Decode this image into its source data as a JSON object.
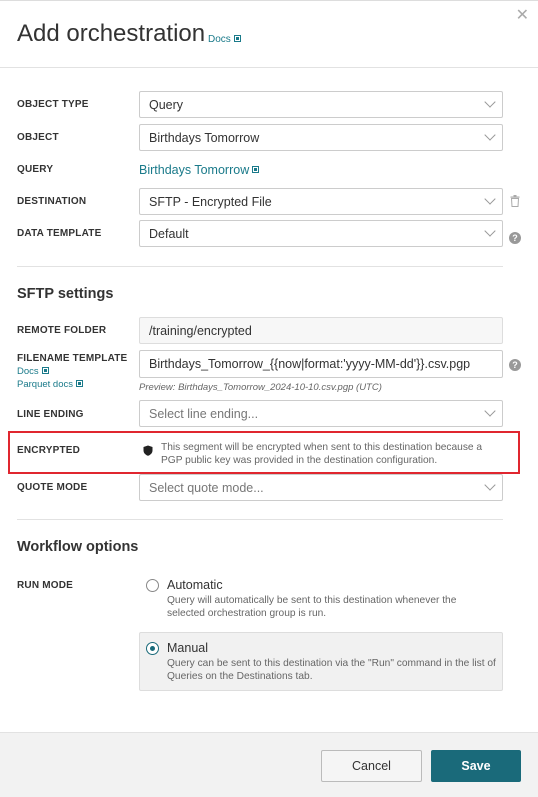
{
  "header": {
    "title": "Add orchestration",
    "docs_label": "Docs"
  },
  "form": {
    "object_type": {
      "label": "OBJECT TYPE",
      "value": "Query"
    },
    "object": {
      "label": "OBJECT",
      "value": "Birthdays Tomorrow"
    },
    "query": {
      "label": "QUERY",
      "link": "Birthdays Tomorrow"
    },
    "destination": {
      "label": "DESTINATION",
      "value": "SFTP - Encrypted File"
    },
    "data_template": {
      "label": "DATA TEMPLATE",
      "value": "Default"
    }
  },
  "sftp": {
    "heading": "SFTP settings",
    "remote_folder": {
      "label": "REMOTE FOLDER",
      "value": "/training/encrypted"
    },
    "filename_template": {
      "label": "FILENAME TEMPLATE",
      "docs_label": "Docs",
      "parquet_docs_label": "Parquet docs",
      "value": "Birthdays_Tomorrow_{{now|format:'yyyy-MM-dd'}}.csv.pgp",
      "preview": "Preview: Birthdays_Tomorrow_2024-10-10.csv.pgp (UTC)"
    },
    "line_ending": {
      "label": "LINE ENDING",
      "placeholder": "Select line ending..."
    },
    "encrypted": {
      "label": "ENCRYPTED",
      "text": "This segment will be encrypted when sent to this destination because a PGP public key was provided in the destination configuration."
    },
    "quote_mode": {
      "label": "QUOTE MODE",
      "placeholder": "Select quote mode..."
    }
  },
  "workflow": {
    "heading": "Workflow options",
    "run_mode_label": "RUN MODE",
    "options": [
      {
        "title": "Automatic",
        "desc": "Query will automatically be sent to this destination whenever the selected orchestration group is run.",
        "selected": false
      },
      {
        "title": "Manual",
        "desc": "Query can be sent to this destination via the \"Run\" command in the list of Queries on the Destinations tab.",
        "selected": true
      }
    ]
  },
  "footer": {
    "cancel_label": "Cancel",
    "save_label": "Save"
  },
  "colors": {
    "accent": "#1a6a7a",
    "link": "#1a7a8a",
    "highlight": "#e0262f"
  },
  "icons": {
    "close": "close-icon",
    "external": "external-link-icon",
    "help": "help-icon",
    "trash": "trash-icon",
    "shield": "shield-icon"
  }
}
